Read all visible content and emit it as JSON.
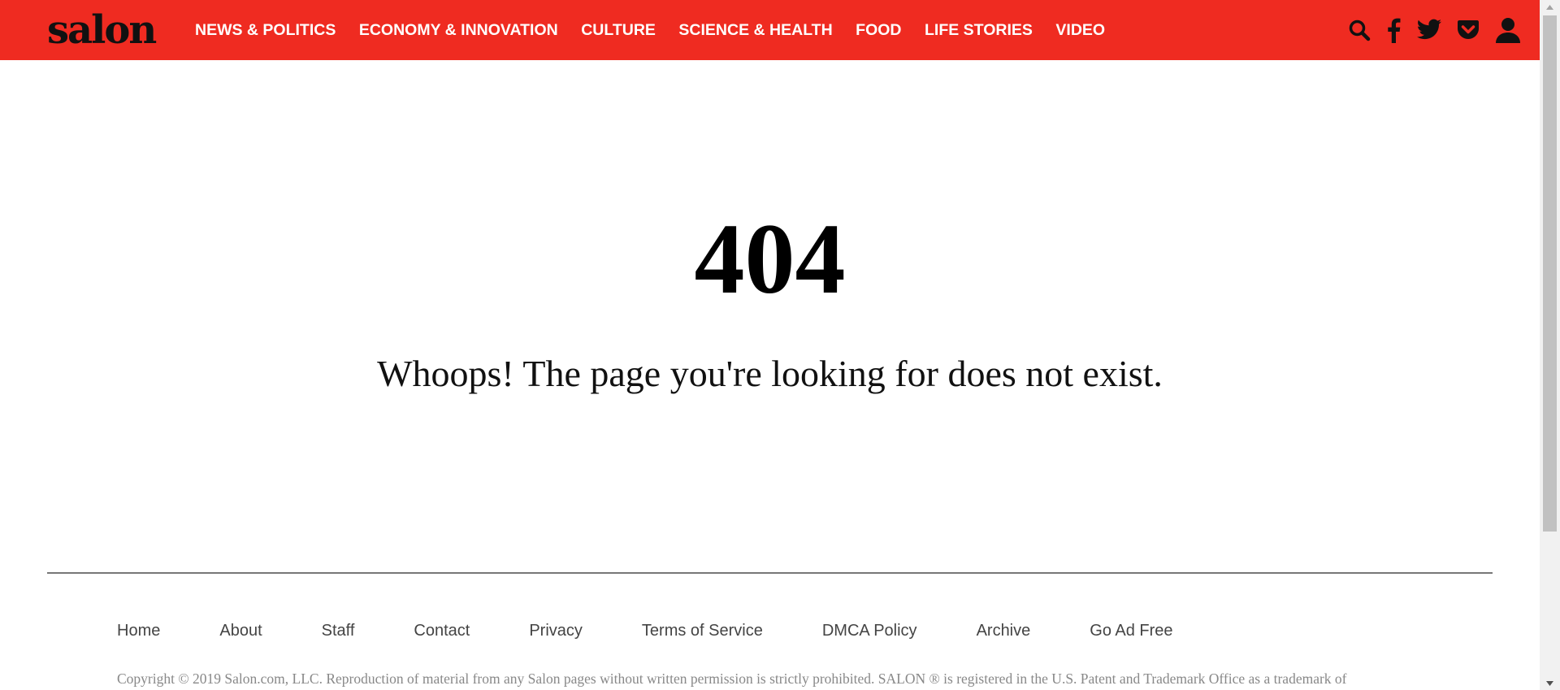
{
  "header": {
    "logo": "salon",
    "bg_color": "#ef2b21",
    "nav": [
      {
        "label": "NEWS & POLITICS"
      },
      {
        "label": "ECONOMY & INNOVATION"
      },
      {
        "label": "CULTURE"
      },
      {
        "label": "SCIENCE & HEALTH"
      },
      {
        "label": "FOOD"
      },
      {
        "label": "LIFE STORIES"
      },
      {
        "label": "VIDEO"
      }
    ],
    "icons": [
      "search-icon",
      "facebook-icon",
      "twitter-icon",
      "pocket-icon",
      "user-icon"
    ]
  },
  "main": {
    "error_code": "404",
    "message": "Whoops! The page you're looking for does not exist."
  },
  "footer": {
    "links": [
      {
        "label": "Home"
      },
      {
        "label": "About"
      },
      {
        "label": "Staff"
      },
      {
        "label": "Contact"
      },
      {
        "label": "Privacy"
      },
      {
        "label": "Terms of Service"
      },
      {
        "label": "DMCA Policy"
      },
      {
        "label": "Archive"
      },
      {
        "label": "Go Ad Free"
      }
    ],
    "copyright": "Copyright © 2019 Salon.com, LLC. Reproduction of material from any Salon pages without written permission is strictly prohibited. SALON ® is registered in the U.S. Patent and Trademark Office as a trademark of"
  }
}
